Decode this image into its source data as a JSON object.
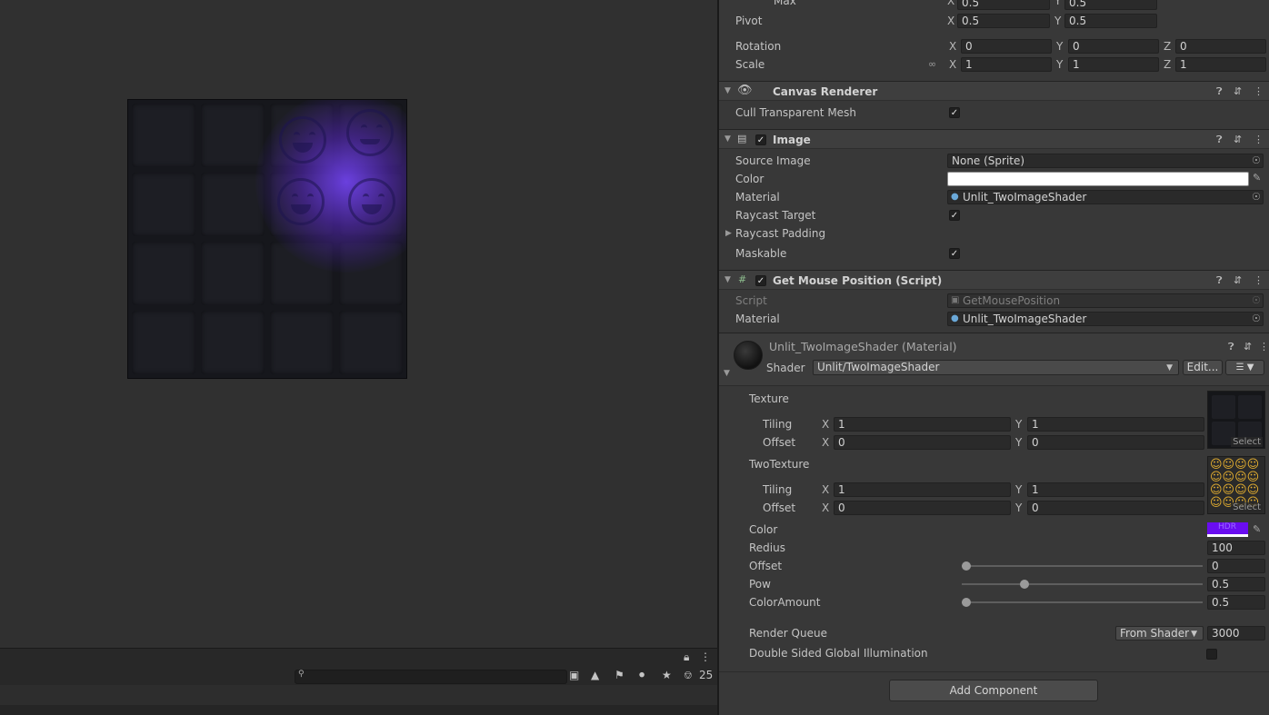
{
  "rect_transform": {
    "max_label": "Max",
    "max_x": "0.5",
    "max_y": "0.5",
    "pivot_label": "Pivot",
    "pivot_x": "0.5",
    "pivot_y": "0.5",
    "rotation_label": "Rotation",
    "rot_x": "0",
    "rot_y": "0",
    "rot_z": "0",
    "scale_label": "Scale",
    "scale_x": "1",
    "scale_y": "1",
    "scale_z": "1",
    "axis_x": "X",
    "axis_y": "Y",
    "axis_z": "Z"
  },
  "canvas_renderer": {
    "title": "Canvas Renderer",
    "cull_label": "Cull Transparent Mesh"
  },
  "image": {
    "title": "Image",
    "source_label": "Source Image",
    "source_value": "None (Sprite)",
    "color_label": "Color",
    "color_value": "#ffffff",
    "material_label": "Material",
    "material_value": "Unlit_TwoImageShader",
    "raycast_label": "Raycast Target",
    "padding_label": "Raycast Padding",
    "maskable_label": "Maskable"
  },
  "mouse_script": {
    "title": "Get Mouse Position (Script)",
    "script_label": "Script",
    "script_value": "GetMousePosition",
    "material_label": "Material",
    "material_value": "Unlit_TwoImageShader"
  },
  "material": {
    "title": "Unlit_TwoImageShader (Material)",
    "shader_label": "Shader",
    "shader_value": "Unlit/TwoImageShader",
    "edit_label": "Edit...",
    "texture_label": "Texture",
    "tiling_label": "Tiling",
    "offset_label": "Offset",
    "tex_tiling_x": "1",
    "tex_tiling_y": "1",
    "tex_offset_x": "0",
    "tex_offset_y": "0",
    "two_texture_label": "TwoTexture",
    "two_tiling_x": "1",
    "two_tiling_y": "1",
    "two_offset_x": "0",
    "two_offset_y": "0",
    "select_label": "Select",
    "color_label": "Color",
    "color_value": "#6a0df0",
    "hdr_label": "HDR",
    "redius_label": "Redius",
    "redius_value": "100",
    "offset_prop_label": "Offset",
    "offset_prop_value": "0",
    "offset_slider": 0.0,
    "pow_label": "Pow",
    "pow_value": "0.5",
    "pow_slider": 0.25,
    "color_amount_label": "ColorAmount",
    "color_amount_value": "0.5",
    "color_amount_slider": 0.0,
    "render_queue_label": "Render Queue",
    "render_queue_mode": "From Shader",
    "render_queue_value": "3000",
    "dsgi_label": "Double Sided Global Illumination"
  },
  "add_component_label": "Add Component",
  "console": {
    "hidden_count": "25"
  },
  "icons": {
    "help": "question-circle-icon",
    "preset": "sliders-icon",
    "menu": "kebab-menu-icon",
    "lock": "lock-icon",
    "search": "search-icon",
    "eye": "eye-icon",
    "picker": "object-picker-icon",
    "eyedropper": "eyedropper-icon"
  }
}
